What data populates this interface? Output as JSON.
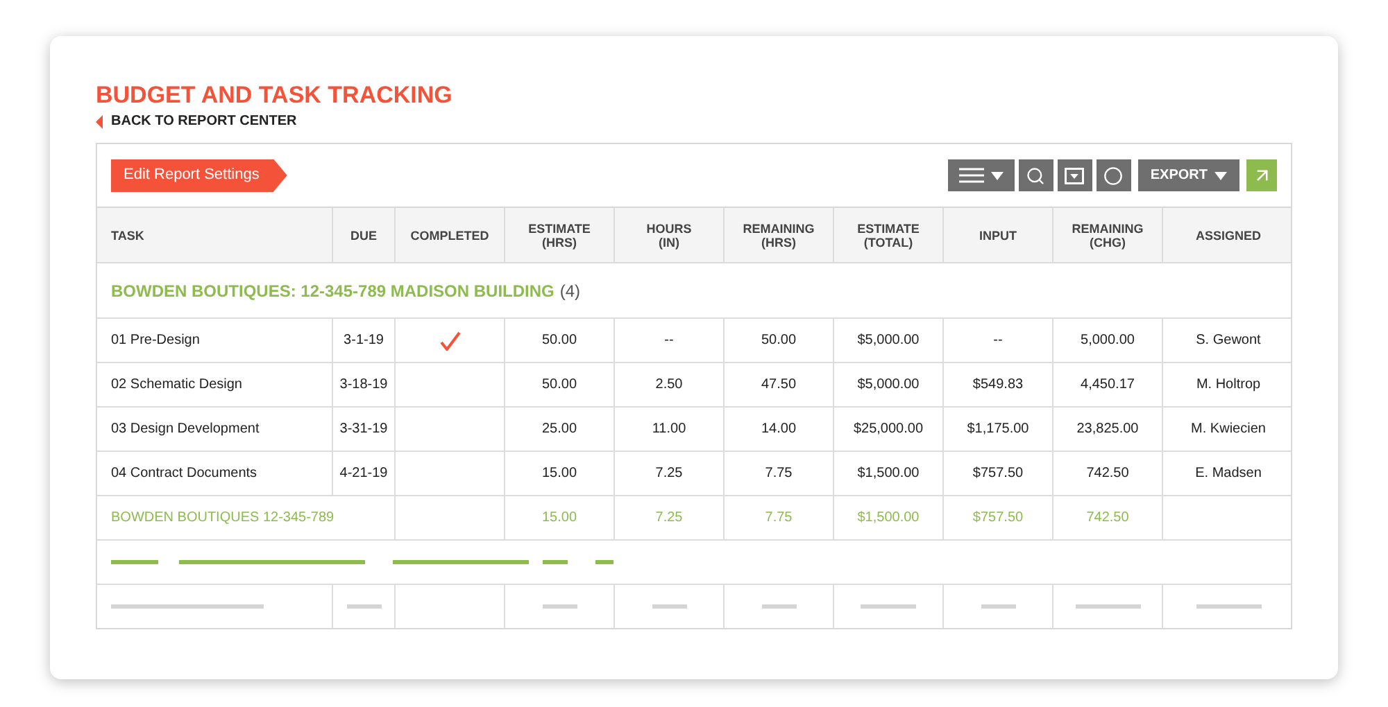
{
  "title": "BUDGET AND TASK TRACKING",
  "back_link": "BACK TO REPORT CENTER",
  "edit_button": "Edit Report Settings",
  "toolbar": {
    "export_button": "EXPORT"
  },
  "table": {
    "columns": [
      "TASK",
      "DUE",
      "COMPLETED",
      "ESTIMATE\n(HRS)",
      "HOURS\n(IN)",
      "REMAINING\n(HRS)",
      "ESTIMATE\n(TOTAL)",
      "INPUT",
      "REMAINING\n(CHG)",
      "ASSIGNED"
    ],
    "group": {
      "name": "BOWDEN BOUTIQUES: 12-345-789 MADISON BUILDING",
      "count": "(4)"
    },
    "rows": [
      {
        "task": "01 Pre-Design",
        "due": "3-1-19",
        "completed": true,
        "values": [
          "50.00",
          "--",
          "50.00",
          "$5,000.00",
          "--",
          "5,000.00"
        ],
        "assigned": "S. Gewont"
      },
      {
        "task": "02 Schematic Design",
        "due": "3-18-19",
        "completed": false,
        "values": [
          "50.00",
          "2.50",
          "47.50",
          "$5,000.00",
          "$549.83",
          "4,450.17"
        ],
        "assigned": "M. Holtrop"
      },
      {
        "task": "03 Design Development",
        "due": "3-31-19",
        "completed": false,
        "values": [
          "25.00",
          "11.00",
          "14.00",
          "$25,000.00",
          "$1,175.00",
          "23,825.00"
        ],
        "assigned": "M. Kwiecien"
      },
      {
        "task": "04 Contract Documents",
        "due": "4-21-19",
        "completed": false,
        "values": [
          "15.00",
          "7.25",
          "7.75",
          "$1,500.00",
          "$757.50",
          "742.50"
        ],
        "assigned": "E. Madsen"
      }
    ],
    "total": {
      "label": "BOWDEN BOUTIQUES 12-345-789",
      "values": [
        "15.00",
        "7.25",
        "7.75",
        "$1,500.00",
        "$757.50",
        "742.50"
      ]
    }
  }
}
